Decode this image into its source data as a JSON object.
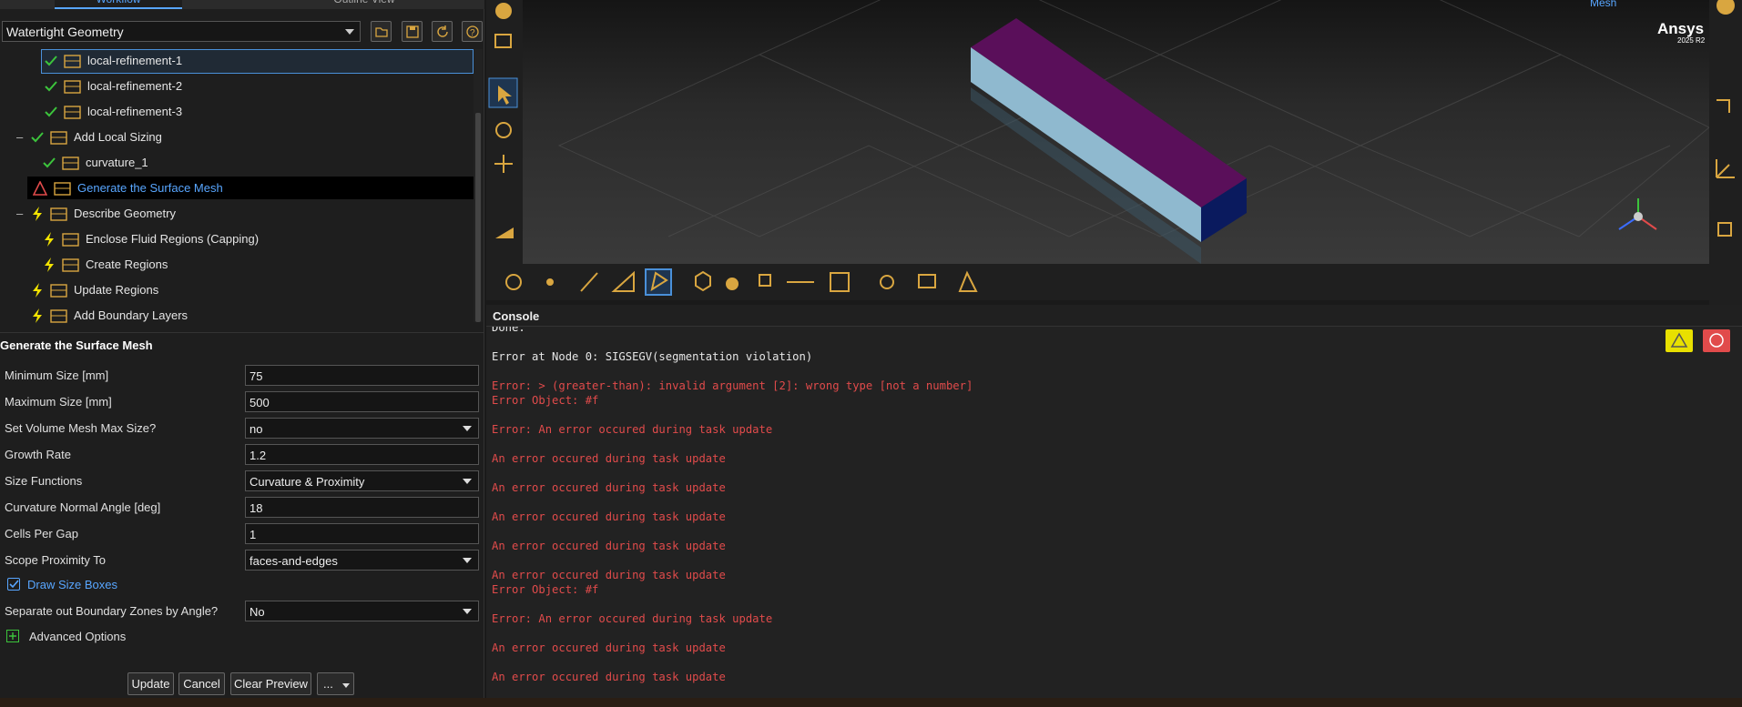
{
  "tabs": [
    "Workflow",
    "Outline View"
  ],
  "workflow_select": "Watertight Geometry",
  "tree": [
    {
      "label": "local-refinement-1",
      "status": "ok",
      "level": 3,
      "selected": true
    },
    {
      "label": "local-refinement-2",
      "status": "ok",
      "level": 3
    },
    {
      "label": "local-refinement-3",
      "status": "ok",
      "level": 3
    },
    {
      "label": "Add Local Sizing",
      "status": "ok",
      "level": 1,
      "expand": "-"
    },
    {
      "label": "curvature_1",
      "status": "ok",
      "level": 2
    },
    {
      "label": "Generate the Surface Mesh",
      "status": "error",
      "level": 1
    },
    {
      "label": "Describe Geometry",
      "status": "pending",
      "level": 1,
      "expand": "-"
    },
    {
      "label": "Enclose Fluid Regions (Capping)",
      "status": "pending",
      "level": 2
    },
    {
      "label": "Create Regions",
      "status": "pending",
      "level": 2
    },
    {
      "label": "Update Regions",
      "status": "pending",
      "level": 1
    },
    {
      "label": "Add Boundary Layers",
      "status": "pending",
      "level": 1
    }
  ],
  "props": {
    "title": "Generate the Surface Mesh",
    "rows": [
      {
        "label": "Minimum Size [mm]",
        "value": "75",
        "type": "text"
      },
      {
        "label": "Maximum Size [mm]",
        "value": "500",
        "type": "text"
      },
      {
        "label": "Set Volume Mesh Max Size?",
        "value": "no",
        "type": "dd"
      },
      {
        "label": "Growth Rate",
        "value": "1.2",
        "type": "text"
      },
      {
        "label": "Size Functions",
        "value": "Curvature & Proximity",
        "type": "dd"
      },
      {
        "label": "Curvature Normal Angle [deg]",
        "value": "18",
        "type": "text"
      },
      {
        "label": "Cells Per Gap",
        "value": "1",
        "type": "text"
      },
      {
        "label": "Scope Proximity To",
        "value": "faces-and-edges",
        "type": "dd"
      }
    ],
    "draw_size_boxes": "Draw Size Boxes",
    "separate": {
      "label": "Separate out Boundary Zones by Angle?",
      "value": "No"
    },
    "advanced": "Advanced Options"
  },
  "buttons": {
    "update": "Update",
    "cancel": "Cancel",
    "clear": "Clear Preview",
    "more": "..."
  },
  "viewport": {
    "title": "Mesh",
    "brand": "Ansys",
    "version": "2025 R2"
  },
  "console": {
    "title": "Console",
    "lines": [
      {
        "t": "Done.",
        "c": "w"
      },
      {
        "t": "Error at Node 0: SIGSEGV(segmentation violation)",
        "c": "w"
      },
      {
        "t": "Error: > (greater-than): invalid argument [2]: wrong type [not a number]",
        "c": "r"
      },
      {
        "t": "Error Object: #f",
        "c": "r"
      },
      {
        "t": "Error: An error occured during task update",
        "c": "r"
      },
      {
        "t": "An error occured during task update",
        "c": "r"
      },
      {
        "t": "An error occured during task update",
        "c": "r"
      },
      {
        "t": "An error occured during task update",
        "c": "r"
      },
      {
        "t": "An error occured during task update",
        "c": "r"
      },
      {
        "t": "An error occured during task update",
        "c": "r"
      },
      {
        "t": "Error Object: #f",
        "c": "r"
      },
      {
        "t": "Error: An error occured during task update",
        "c": "r"
      },
      {
        "t": "An error occured during task update",
        "c": "r"
      },
      {
        "t": "An error occured during task update",
        "c": "r"
      }
    ]
  },
  "colors": {
    "accent": "#58a6ff",
    "error": "#e14b4b",
    "ok": "#3cc43c",
    "pending": "#f2e300"
  }
}
